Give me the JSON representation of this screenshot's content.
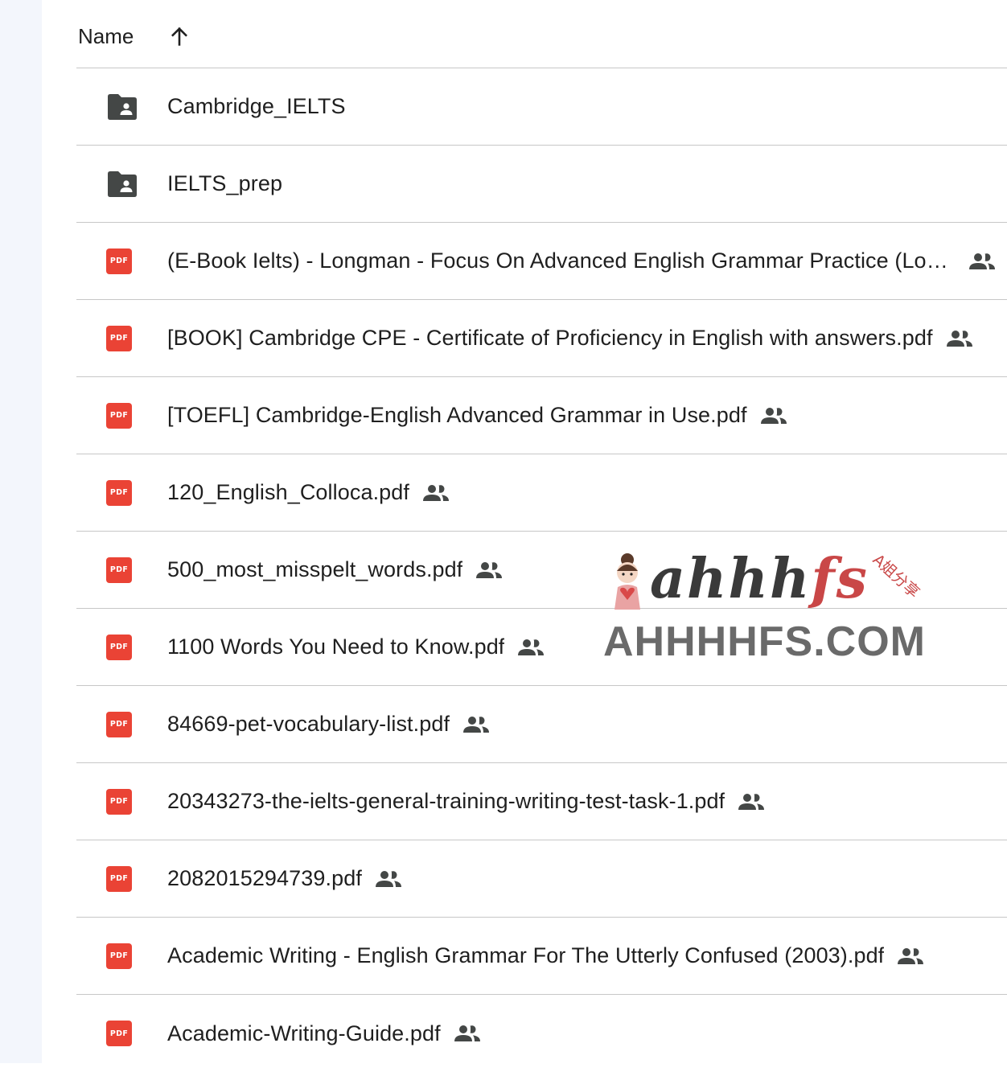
{
  "header": {
    "name_label": "Name",
    "sort_icon": "arrow-upward-icon"
  },
  "files": [
    {
      "name": "Cambridge_IELTS",
      "type": "shared-folder",
      "shared": false
    },
    {
      "name": "IELTS_prep",
      "type": "shared-folder",
      "shared": false
    },
    {
      "name": "(E-Book Ielts) - Longman - Focus On Advanced English Grammar Practice (Longman Keys to Language Teaching).pdf",
      "type": "pdf",
      "shared": true
    },
    {
      "name": "[BOOK] Cambridge CPE - Certificate of Proficiency in English with answers.pdf",
      "type": "pdf",
      "shared": true
    },
    {
      "name": "[TOEFL] Cambridge-English Advanced Grammar in Use.pdf",
      "type": "pdf",
      "shared": true
    },
    {
      "name": "120_English_Colloca.pdf",
      "type": "pdf",
      "shared": true
    },
    {
      "name": "500_most_misspelt_words.pdf",
      "type": "pdf",
      "shared": true
    },
    {
      "name": "1100 Words You Need to Know.pdf",
      "type": "pdf",
      "shared": true
    },
    {
      "name": "84669-pet-vocabulary-list.pdf",
      "type": "pdf",
      "shared": true
    },
    {
      "name": "20343273-the-ielts-general-training-writing-test-task-1.pdf",
      "type": "pdf",
      "shared": true
    },
    {
      "name": "2082015294739.pdf",
      "type": "pdf",
      "shared": true
    },
    {
      "name": "Academic Writing - English Grammar For The Utterly Confused (2003).pdf",
      "type": "pdf",
      "shared": true
    },
    {
      "name": "Academic-Writing-Guide.pdf",
      "type": "pdf",
      "shared": true
    }
  ],
  "icons": {
    "folder": "shared-folder-icon",
    "pdf": "pdf-icon",
    "shared": "people-icon",
    "pdf_badge_text": "PDF"
  },
  "colors": {
    "pdf_red": "#ea4335",
    "folder_gray": "#444746",
    "divider": "#c7c7c7",
    "text": "#1f1f1f"
  },
  "watermark": {
    "script_main": "ahhh",
    "script_accent": "fs",
    "domain": "AHHHHFS.COM",
    "cn_tag": "A姐分享"
  }
}
